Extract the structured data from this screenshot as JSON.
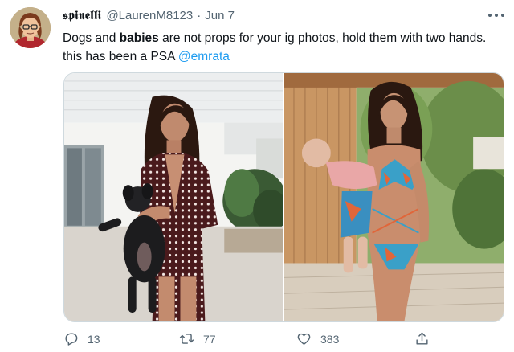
{
  "tweet": {
    "display_name": "𝖘𝖕𝖎𝖓𝖊𝖑𝖑𝖎",
    "handle": "@LaurenM8123",
    "separator": "·",
    "date": "Jun 7",
    "text_part1": "Dogs and ",
    "text_bold": "babies",
    "text_part2": " are not props for your ig photos, hold them with two hands. this has been a PSA ",
    "mention": "@emrata"
  },
  "media": {
    "photos": [
      {
        "icon": "photo-woman-holding-puppy"
      },
      {
        "icon": "photo-woman-holding-baby"
      }
    ]
  },
  "actions": {
    "replies": "13",
    "retweets": "77",
    "likes": "383"
  },
  "icons": {
    "reply": "reply-icon",
    "retweet": "retweet-icon",
    "like": "heart-icon",
    "share": "share-icon",
    "more": "more-icon"
  },
  "colors": {
    "accent": "#1d9bf0",
    "secondary_text": "#536471",
    "primary_text": "#0f1419",
    "border": "#cfd9de"
  }
}
